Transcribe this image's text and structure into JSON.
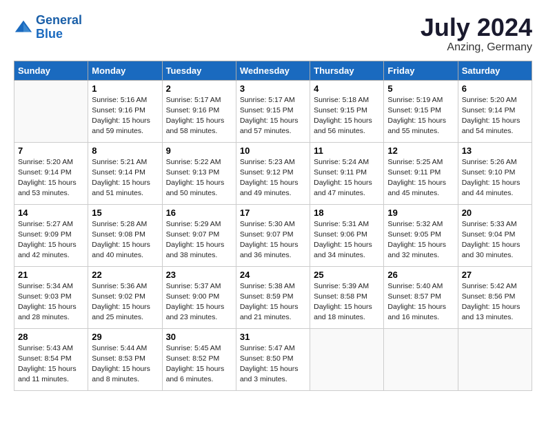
{
  "header": {
    "logo_line1": "General",
    "logo_line2": "Blue",
    "month_year": "July 2024",
    "location": "Anzing, Germany"
  },
  "weekdays": [
    "Sunday",
    "Monday",
    "Tuesday",
    "Wednesday",
    "Thursday",
    "Friday",
    "Saturday"
  ],
  "weeks": [
    [
      {
        "day": "",
        "sunrise": "",
        "sunset": "",
        "daylight": ""
      },
      {
        "day": "1",
        "sunrise": "Sunrise: 5:16 AM",
        "sunset": "Sunset: 9:16 PM",
        "daylight": "Daylight: 15 hours and 59 minutes."
      },
      {
        "day": "2",
        "sunrise": "Sunrise: 5:17 AM",
        "sunset": "Sunset: 9:16 PM",
        "daylight": "Daylight: 15 hours and 58 minutes."
      },
      {
        "day": "3",
        "sunrise": "Sunrise: 5:17 AM",
        "sunset": "Sunset: 9:15 PM",
        "daylight": "Daylight: 15 hours and 57 minutes."
      },
      {
        "day": "4",
        "sunrise": "Sunrise: 5:18 AM",
        "sunset": "Sunset: 9:15 PM",
        "daylight": "Daylight: 15 hours and 56 minutes."
      },
      {
        "day": "5",
        "sunrise": "Sunrise: 5:19 AM",
        "sunset": "Sunset: 9:15 PM",
        "daylight": "Daylight: 15 hours and 55 minutes."
      },
      {
        "day": "6",
        "sunrise": "Sunrise: 5:20 AM",
        "sunset": "Sunset: 9:14 PM",
        "daylight": "Daylight: 15 hours and 54 minutes."
      }
    ],
    [
      {
        "day": "7",
        "sunrise": "Sunrise: 5:20 AM",
        "sunset": "Sunset: 9:14 PM",
        "daylight": "Daylight: 15 hours and 53 minutes."
      },
      {
        "day": "8",
        "sunrise": "Sunrise: 5:21 AM",
        "sunset": "Sunset: 9:14 PM",
        "daylight": "Daylight: 15 hours and 51 minutes."
      },
      {
        "day": "9",
        "sunrise": "Sunrise: 5:22 AM",
        "sunset": "Sunset: 9:13 PM",
        "daylight": "Daylight: 15 hours and 50 minutes."
      },
      {
        "day": "10",
        "sunrise": "Sunrise: 5:23 AM",
        "sunset": "Sunset: 9:12 PM",
        "daylight": "Daylight: 15 hours and 49 minutes."
      },
      {
        "day": "11",
        "sunrise": "Sunrise: 5:24 AM",
        "sunset": "Sunset: 9:11 PM",
        "daylight": "Daylight: 15 hours and 47 minutes."
      },
      {
        "day": "12",
        "sunrise": "Sunrise: 5:25 AM",
        "sunset": "Sunset: 9:11 PM",
        "daylight": "Daylight: 15 hours and 45 minutes."
      },
      {
        "day": "13",
        "sunrise": "Sunrise: 5:26 AM",
        "sunset": "Sunset: 9:10 PM",
        "daylight": "Daylight: 15 hours and 44 minutes."
      }
    ],
    [
      {
        "day": "14",
        "sunrise": "Sunrise: 5:27 AM",
        "sunset": "Sunset: 9:09 PM",
        "daylight": "Daylight: 15 hours and 42 minutes."
      },
      {
        "day": "15",
        "sunrise": "Sunrise: 5:28 AM",
        "sunset": "Sunset: 9:08 PM",
        "daylight": "Daylight: 15 hours and 40 minutes."
      },
      {
        "day": "16",
        "sunrise": "Sunrise: 5:29 AM",
        "sunset": "Sunset: 9:07 PM",
        "daylight": "Daylight: 15 hours and 38 minutes."
      },
      {
        "day": "17",
        "sunrise": "Sunrise: 5:30 AM",
        "sunset": "Sunset: 9:07 PM",
        "daylight": "Daylight: 15 hours and 36 minutes."
      },
      {
        "day": "18",
        "sunrise": "Sunrise: 5:31 AM",
        "sunset": "Sunset: 9:06 PM",
        "daylight": "Daylight: 15 hours and 34 minutes."
      },
      {
        "day": "19",
        "sunrise": "Sunrise: 5:32 AM",
        "sunset": "Sunset: 9:05 PM",
        "daylight": "Daylight: 15 hours and 32 minutes."
      },
      {
        "day": "20",
        "sunrise": "Sunrise: 5:33 AM",
        "sunset": "Sunset: 9:04 PM",
        "daylight": "Daylight: 15 hours and 30 minutes."
      }
    ],
    [
      {
        "day": "21",
        "sunrise": "Sunrise: 5:34 AM",
        "sunset": "Sunset: 9:03 PM",
        "daylight": "Daylight: 15 hours and 28 minutes."
      },
      {
        "day": "22",
        "sunrise": "Sunrise: 5:36 AM",
        "sunset": "Sunset: 9:02 PM",
        "daylight": "Daylight: 15 hours and 25 minutes."
      },
      {
        "day": "23",
        "sunrise": "Sunrise: 5:37 AM",
        "sunset": "Sunset: 9:00 PM",
        "daylight": "Daylight: 15 hours and 23 minutes."
      },
      {
        "day": "24",
        "sunrise": "Sunrise: 5:38 AM",
        "sunset": "Sunset: 8:59 PM",
        "daylight": "Daylight: 15 hours and 21 minutes."
      },
      {
        "day": "25",
        "sunrise": "Sunrise: 5:39 AM",
        "sunset": "Sunset: 8:58 PM",
        "daylight": "Daylight: 15 hours and 18 minutes."
      },
      {
        "day": "26",
        "sunrise": "Sunrise: 5:40 AM",
        "sunset": "Sunset: 8:57 PM",
        "daylight": "Daylight: 15 hours and 16 minutes."
      },
      {
        "day": "27",
        "sunrise": "Sunrise: 5:42 AM",
        "sunset": "Sunset: 8:56 PM",
        "daylight": "Daylight: 15 hours and 13 minutes."
      }
    ],
    [
      {
        "day": "28",
        "sunrise": "Sunrise: 5:43 AM",
        "sunset": "Sunset: 8:54 PM",
        "daylight": "Daylight: 15 hours and 11 minutes."
      },
      {
        "day": "29",
        "sunrise": "Sunrise: 5:44 AM",
        "sunset": "Sunset: 8:53 PM",
        "daylight": "Daylight: 15 hours and 8 minutes."
      },
      {
        "day": "30",
        "sunrise": "Sunrise: 5:45 AM",
        "sunset": "Sunset: 8:52 PM",
        "daylight": "Daylight: 15 hours and 6 minutes."
      },
      {
        "day": "31",
        "sunrise": "Sunrise: 5:47 AM",
        "sunset": "Sunset: 8:50 PM",
        "daylight": "Daylight: 15 hours and 3 minutes."
      },
      {
        "day": "",
        "sunrise": "",
        "sunset": "",
        "daylight": ""
      },
      {
        "day": "",
        "sunrise": "",
        "sunset": "",
        "daylight": ""
      },
      {
        "day": "",
        "sunrise": "",
        "sunset": "",
        "daylight": ""
      }
    ]
  ]
}
